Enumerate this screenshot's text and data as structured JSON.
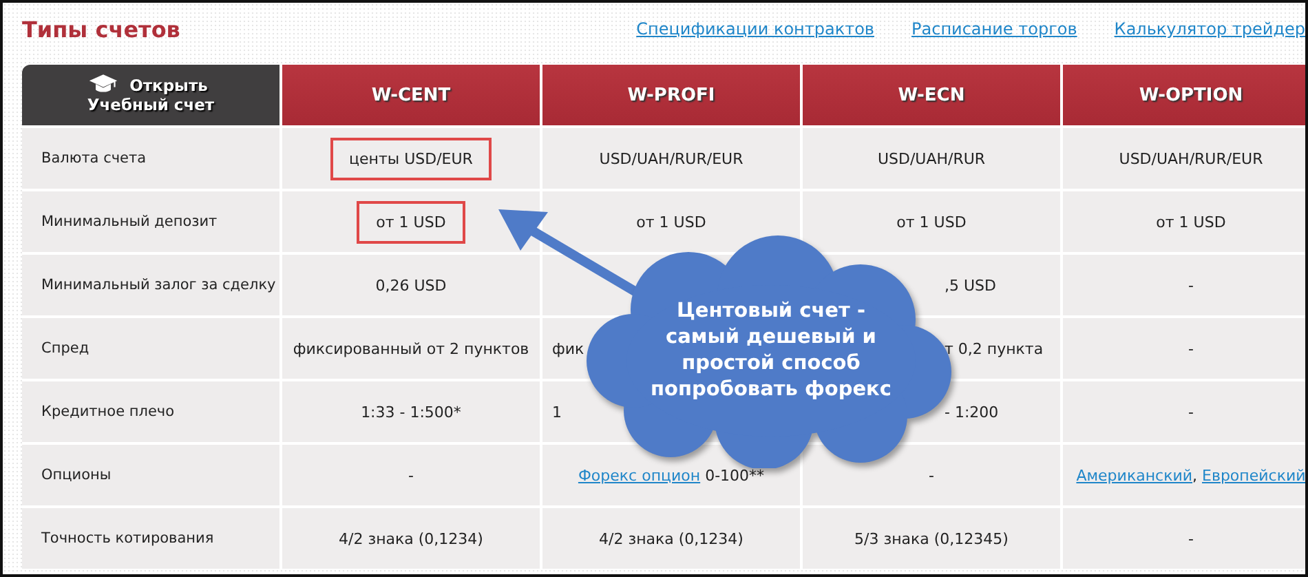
{
  "title": "Типы счетов",
  "links": [
    "Спецификации контрактов",
    "Расписание торгов",
    "Калькулятор трейдер"
  ],
  "table": {
    "corner": {
      "line1": "Открыть",
      "line2": "Учебный счет"
    },
    "columns": [
      "W-CENT",
      "W-PROFI",
      "W-ECN",
      "W-OPTION"
    ],
    "rows": [
      {
        "label": "Валюта счета",
        "cells": [
          {
            "text": "центы USD/EUR",
            "boxed": true
          },
          {
            "text": "USD/UAH/RUR/EUR"
          },
          {
            "text": "USD/UAH/RUR"
          },
          {
            "text": "USD/UAH/RUR/EUR"
          }
        ]
      },
      {
        "label": "Минимальный депозит",
        "cells": [
          {
            "text": "от 1 USD",
            "boxed": true
          },
          {
            "text": "от 1 USD"
          },
          {
            "text": "от 1 USD"
          },
          {
            "text": "от 1 USD"
          }
        ]
      },
      {
        "label": "Минимальный залог за сделку",
        "cells": [
          {
            "text": "0,26 USD"
          },
          {
            "kind": "covered"
          },
          {
            "text": ",5 USD",
            "kind": "clipped_start"
          },
          {
            "text": "-"
          }
        ]
      },
      {
        "label": "Спред",
        "cells": [
          {
            "text": "фиксированный от 2 пунктов"
          },
          {
            "text": "фик",
            "kind": "clipped_end"
          },
          {
            "text": "т 0,2 пункта",
            "kind": "clipped_start"
          },
          {
            "text": "-"
          }
        ]
      },
      {
        "label": "Кредитное плечо",
        "cells": [
          {
            "text": "1:33 - 1:500*"
          },
          {
            "text": "1",
            "kind": "clipped_end"
          },
          {
            "text": "- 1:200",
            "kind": "clipped_start"
          },
          {
            "text": "-"
          }
        ]
      },
      {
        "label": "Опционы",
        "cells": [
          {
            "text": "-"
          },
          {
            "parts": [
              {
                "text": "Форекс опцион",
                "kind": "link"
              },
              {
                "text": " 0-100**",
                "kind": "text"
              }
            ]
          },
          {
            "text": "-"
          },
          {
            "parts": [
              {
                "text": "Американский",
                "kind": "link"
              },
              {
                "text": ", ",
                "kind": "text"
              },
              {
                "text": "Европейский",
                "kind": "link"
              }
            ]
          }
        ]
      },
      {
        "label": "Точность котирования",
        "cells": [
          {
            "text": "4/2 знака (0,1234)"
          },
          {
            "text": "4/2 знака (0,1234)"
          },
          {
            "text": "5/3 знака (0,12345)"
          },
          {
            "text": "-"
          }
        ]
      }
    ]
  },
  "callout": {
    "text": "Центовый счет -\nсамый дешевый и\nпростой способ\nпопробовать форекс"
  }
}
